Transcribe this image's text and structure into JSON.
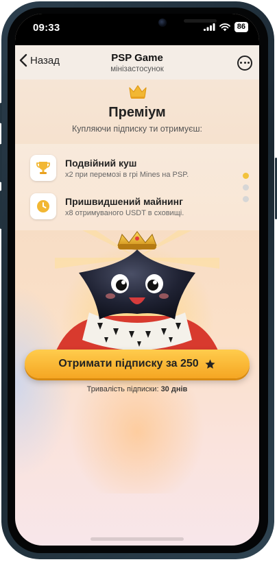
{
  "status_bar": {
    "time": "09:33",
    "battery": "86"
  },
  "header": {
    "back_label": "Назад",
    "title": "PSP Game",
    "subtitle": "мінізастосунок"
  },
  "premium": {
    "title": "Преміум",
    "subtitle": "Купляючи підписку ти отримуєш:"
  },
  "features": [
    {
      "title": "Подвійний куш",
      "description": "x2 при перемозі в грі Mines на PSP.",
      "icon": "trophy-icon"
    },
    {
      "title": "Пришвидшений майнинг",
      "description": "x8 отримуваного USDT в сховищі.",
      "icon": "clock-icon"
    }
  ],
  "pagination": {
    "total": 3,
    "active": 1
  },
  "cta": {
    "label": "Отримати підписку за 250",
    "icon": "star-icon"
  },
  "duration": {
    "label": "Тривалість підписки:",
    "value": "30 днів"
  },
  "colors": {
    "accent": "#f5a623",
    "dot_active": "#f2c23c"
  }
}
